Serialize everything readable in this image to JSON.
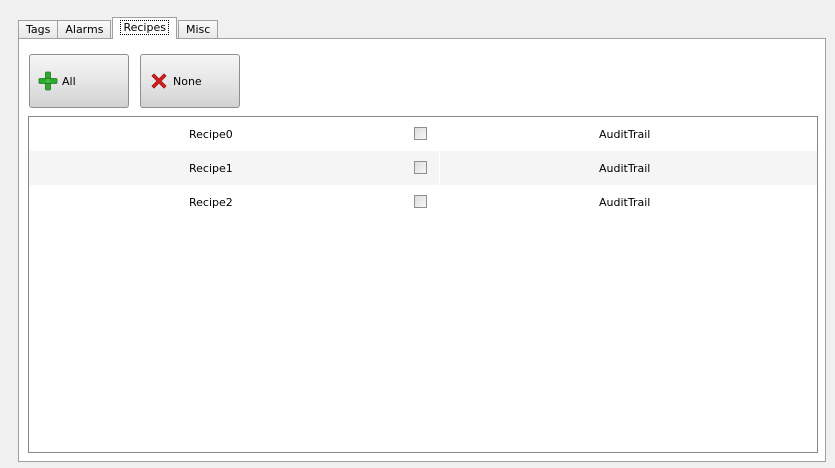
{
  "tabs": [
    {
      "label": "Tags",
      "active": false
    },
    {
      "label": "Alarms",
      "active": false
    },
    {
      "label": "Recipes",
      "active": true
    },
    {
      "label": "Misc",
      "active": false
    }
  ],
  "toolbar": {
    "all_label": "All",
    "none_label": "None",
    "all_icon": "green-plus-icon",
    "none_icon": "red-x-icon"
  },
  "rows": [
    {
      "name": "Recipe0",
      "checked": false,
      "audit": "AuditTrail"
    },
    {
      "name": "Recipe1",
      "checked": false,
      "audit": "AuditTrail"
    },
    {
      "name": "Recipe2",
      "checked": false,
      "audit": "AuditTrail"
    }
  ],
  "colors": {
    "plus": "#2fa82f",
    "cross": "#d81e1e"
  }
}
